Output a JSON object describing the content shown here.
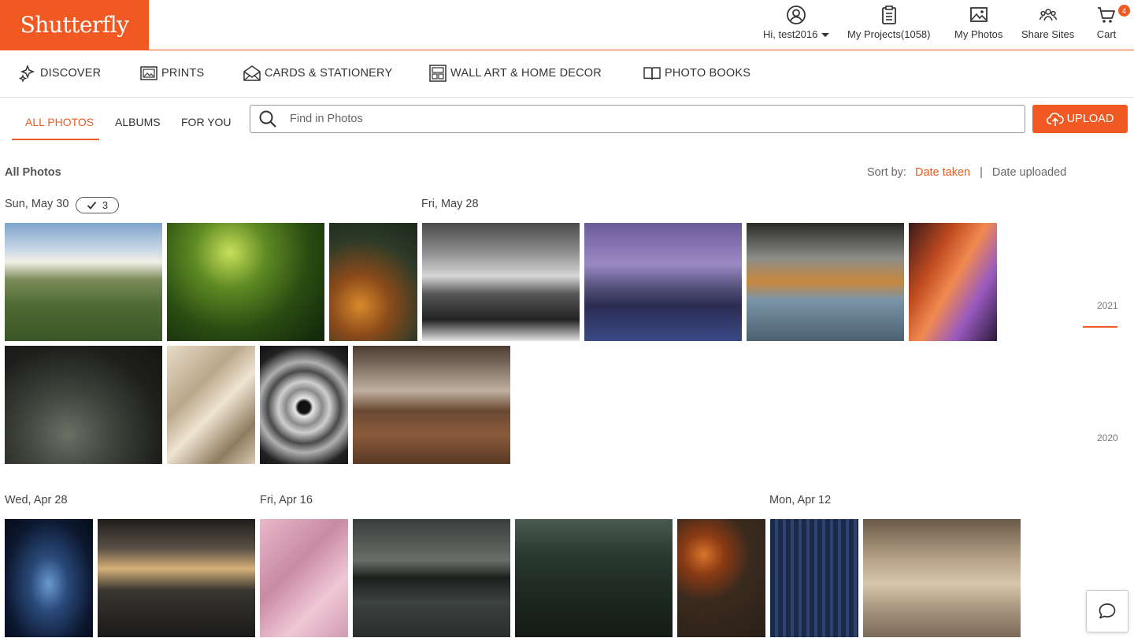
{
  "brand": {
    "logo_text": "Shutterfly",
    "color": "#f05a22"
  },
  "header": {
    "greeting": "Hi, test2016",
    "projects": "My Projects(1058)",
    "photos": "My Photos",
    "share": "Share Sites",
    "cart": "Cart",
    "cart_count": "4"
  },
  "categories": {
    "discover": "DISCOVER",
    "prints": "PRINTS",
    "cards": "CARDS & STATIONERY",
    "wallart": "WALL ART & HOME DECOR",
    "books": "PHOTO BOOKS"
  },
  "tabs": {
    "all": "ALL PHOTOS",
    "albums": "ALBUMS",
    "foryou": "FOR YOU"
  },
  "search": {
    "placeholder": "Find in Photos"
  },
  "upload_label": "UPLOAD",
  "page_title": "All Photos",
  "sort": {
    "label": "Sort by:",
    "taken": "Date taken",
    "separator": "|",
    "uploaded": "Date uploaded"
  },
  "groups": {
    "may30": {
      "date": "Sun, May 30",
      "selected_count": "3"
    },
    "may28": {
      "date": "Fri, May 28"
    },
    "apr28": {
      "date": "Wed, Apr 28"
    },
    "apr16": {
      "date": "Fri, Apr 16"
    },
    "apr12": {
      "date": "Mon, Apr 12"
    }
  },
  "photos": [
    {
      "subject": "aerial green valley with sunburst clouds"
    },
    {
      "subject": "green foggy street lamps at night"
    },
    {
      "subject": "aerial autumn forest with road"
    },
    {
      "subject": "black and white snowy mountain"
    },
    {
      "subject": "city skyline at dusk over water"
    },
    {
      "subject": "rocky coast at sunset"
    },
    {
      "subject": "orange slot canyon"
    },
    {
      "subject": "person on rock in cave"
    },
    {
      "subject": "beige silk fabric"
    },
    {
      "subject": "grey circular spiral pattern"
    },
    {
      "subject": "autumn forest trail"
    },
    {
      "subject": "blue smoke on black"
    },
    {
      "subject": "dark sea with golden sky"
    },
    {
      "subject": "pink textured surface"
    },
    {
      "subject": "pier with ferris wheel at dusk"
    },
    {
      "subject": "misty forested hillside"
    },
    {
      "subject": "dried orange slices on wood"
    },
    {
      "subject": "blue geometric maze pattern"
    },
    {
      "subject": "surfer on misty beach"
    }
  ],
  "timeline": {
    "y2021": "2021",
    "y2020": "2020"
  }
}
